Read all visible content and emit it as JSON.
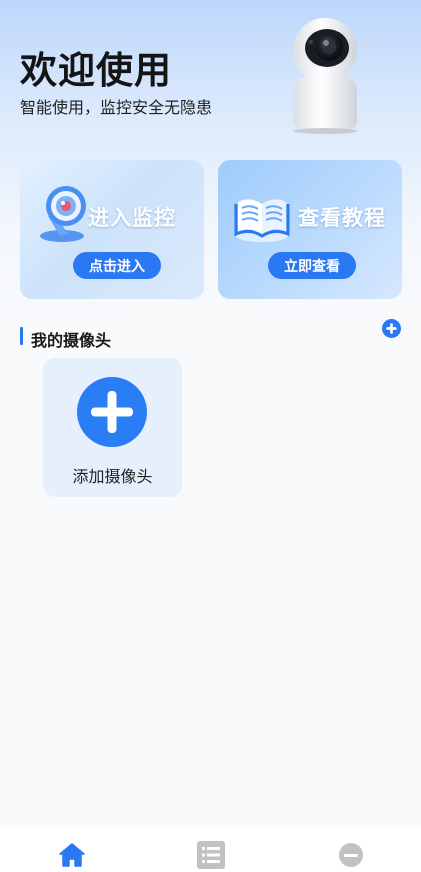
{
  "header": {
    "title": "欢迎使用",
    "subtitle": "智能使用，监控安全无隐患",
    "camera_image": "security-camera-illustration"
  },
  "cards": [
    {
      "title": "进入监控",
      "button": "点击进入",
      "icon": "camera-icon"
    },
    {
      "title": "查看教程",
      "button": "立即查看",
      "icon": "book-icon"
    }
  ],
  "cameras_section": {
    "title": "我的摄像头",
    "add_icon": "plus-circle-icon",
    "add_tile_label": "添加摄像头"
  },
  "tabbar": {
    "items": [
      {
        "icon": "home-icon",
        "active": true
      },
      {
        "icon": "list-icon",
        "active": false
      },
      {
        "icon": "profile-icon",
        "active": false
      }
    ]
  },
  "colors": {
    "accent": "#2a78f3",
    "inactive_icon": "#bfbfbf"
  }
}
